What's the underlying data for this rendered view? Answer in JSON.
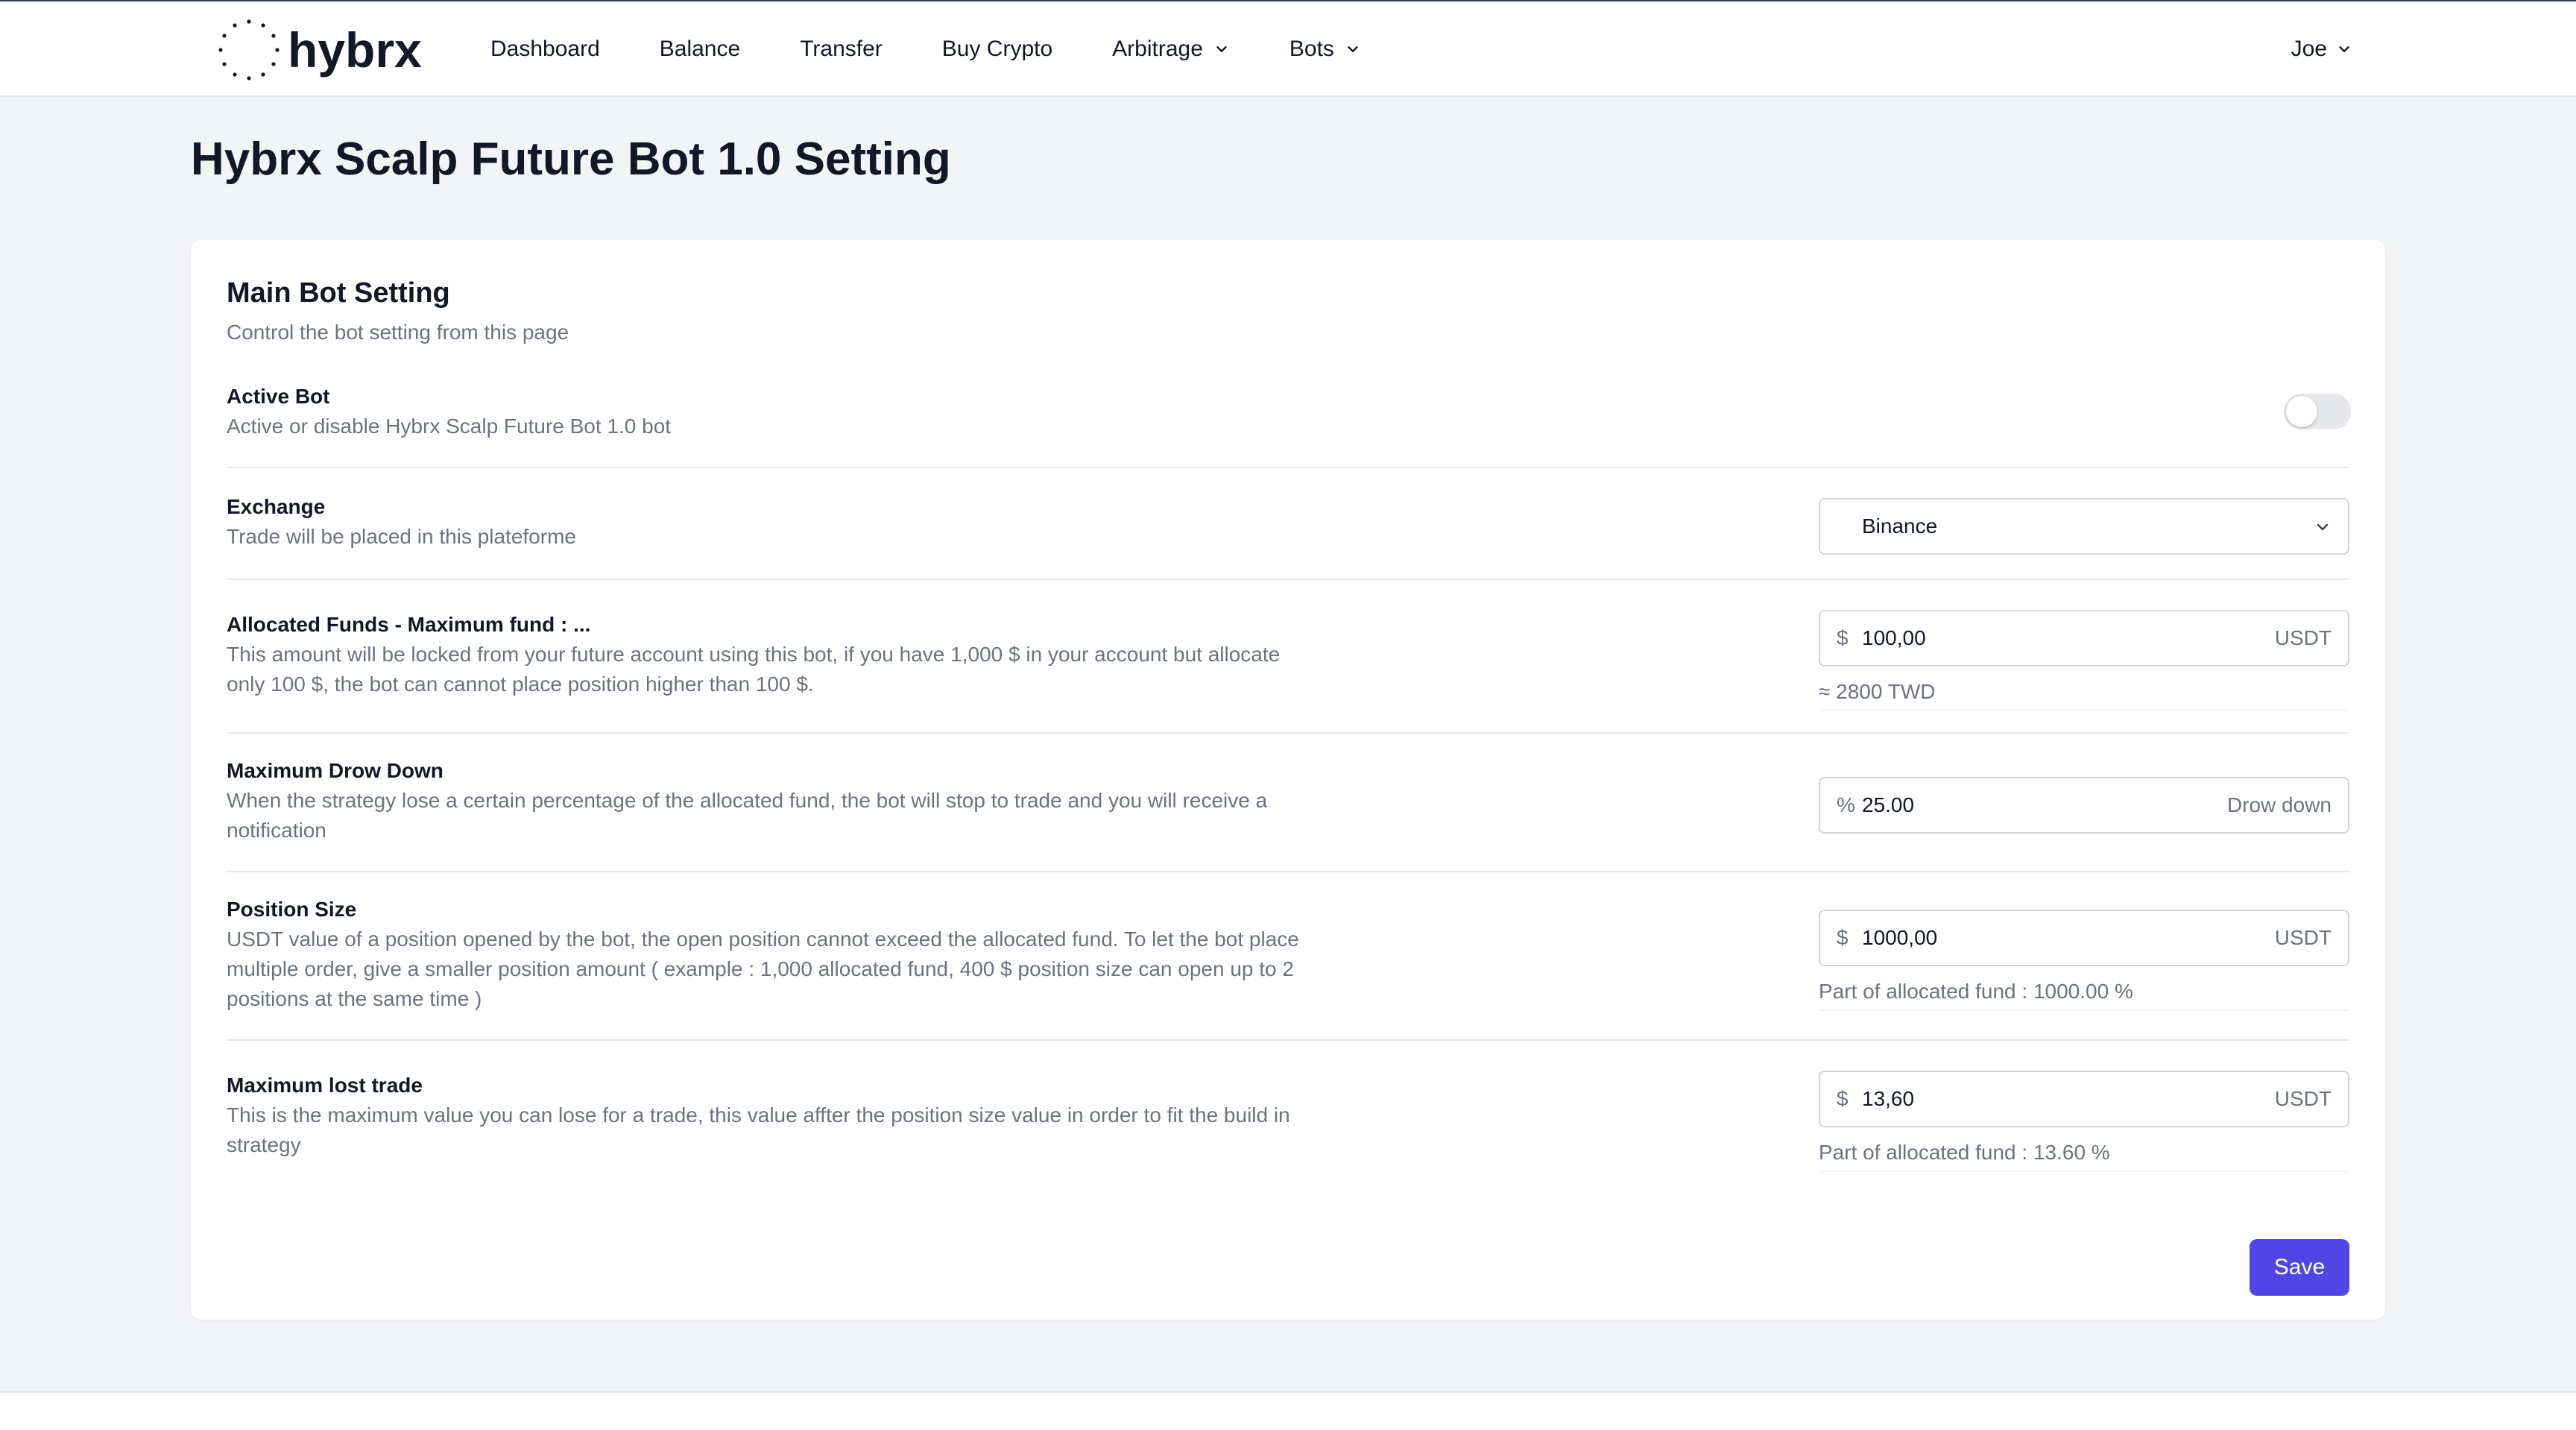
{
  "header": {
    "logo_text": "hybrx",
    "nav": [
      {
        "label": "Dashboard"
      },
      {
        "label": "Balance"
      },
      {
        "label": "Transfer"
      },
      {
        "label": "Buy Crypto"
      },
      {
        "label": "Arbitrage",
        "dropdown": true
      },
      {
        "label": "Bots",
        "dropdown": true
      }
    ],
    "user_name": "Joe"
  },
  "page": {
    "title": "Hybrx Scalp Future Bot 1.0 Setting"
  },
  "card": {
    "title": "Main Bot Setting",
    "subtitle": "Control the bot setting from this page",
    "active_bot": {
      "label": "Active Bot",
      "desc": "Active or disable Hybrx Scalp Future Bot 1.0 bot",
      "enabled": false
    },
    "exchange": {
      "label": "Exchange",
      "desc": "Trade will be placed in this plateforme",
      "selected": "Binance"
    },
    "allocated_funds": {
      "label": "Allocated Funds - Maximum fund : ...",
      "desc": "This amount will be locked from your future account using this bot, if you have 1,000 $ in your account but allocate only 100 $, the bot can cannot place position higher than 100 $.",
      "prefix": "$",
      "value": "100,00",
      "suffix": "USDT",
      "helper": "≈ 2800 TWD"
    },
    "max_drawdown": {
      "label": "Maximum Drow Down",
      "desc": "When the strategy lose a certain percentage of the allocated fund, the bot will stop to trade and you will receive a notification",
      "prefix": "%",
      "value": "25.00",
      "suffix": "Drow down"
    },
    "position_size": {
      "label": "Position Size",
      "desc": "USDT value of a position opened by the bot, the open position cannot exceed the allocated fund. To let the bot place multiple order, give a smaller position amount ( example : 1,000 allocated fund, 400 $ position size can open up to 2 positions at the same time )",
      "prefix": "$",
      "value": "1000,00",
      "suffix": "USDT",
      "helper": "Part of allocated fund : 1000.00 %"
    },
    "max_lost_trade": {
      "label": "Maximum lost trade",
      "desc": "This is the maximum value you can lose for a trade, this value affter the position size value in order to fit the build in strategy",
      "prefix": "$",
      "value": "13,60",
      "suffix": "USDT",
      "helper": "Part of allocated fund : 13.60 %"
    },
    "save_label": "Save"
  },
  "colors": {
    "accent": "#4f46e5",
    "page_bg": "#f3f4f6",
    "muted_text": "#6b7280"
  }
}
